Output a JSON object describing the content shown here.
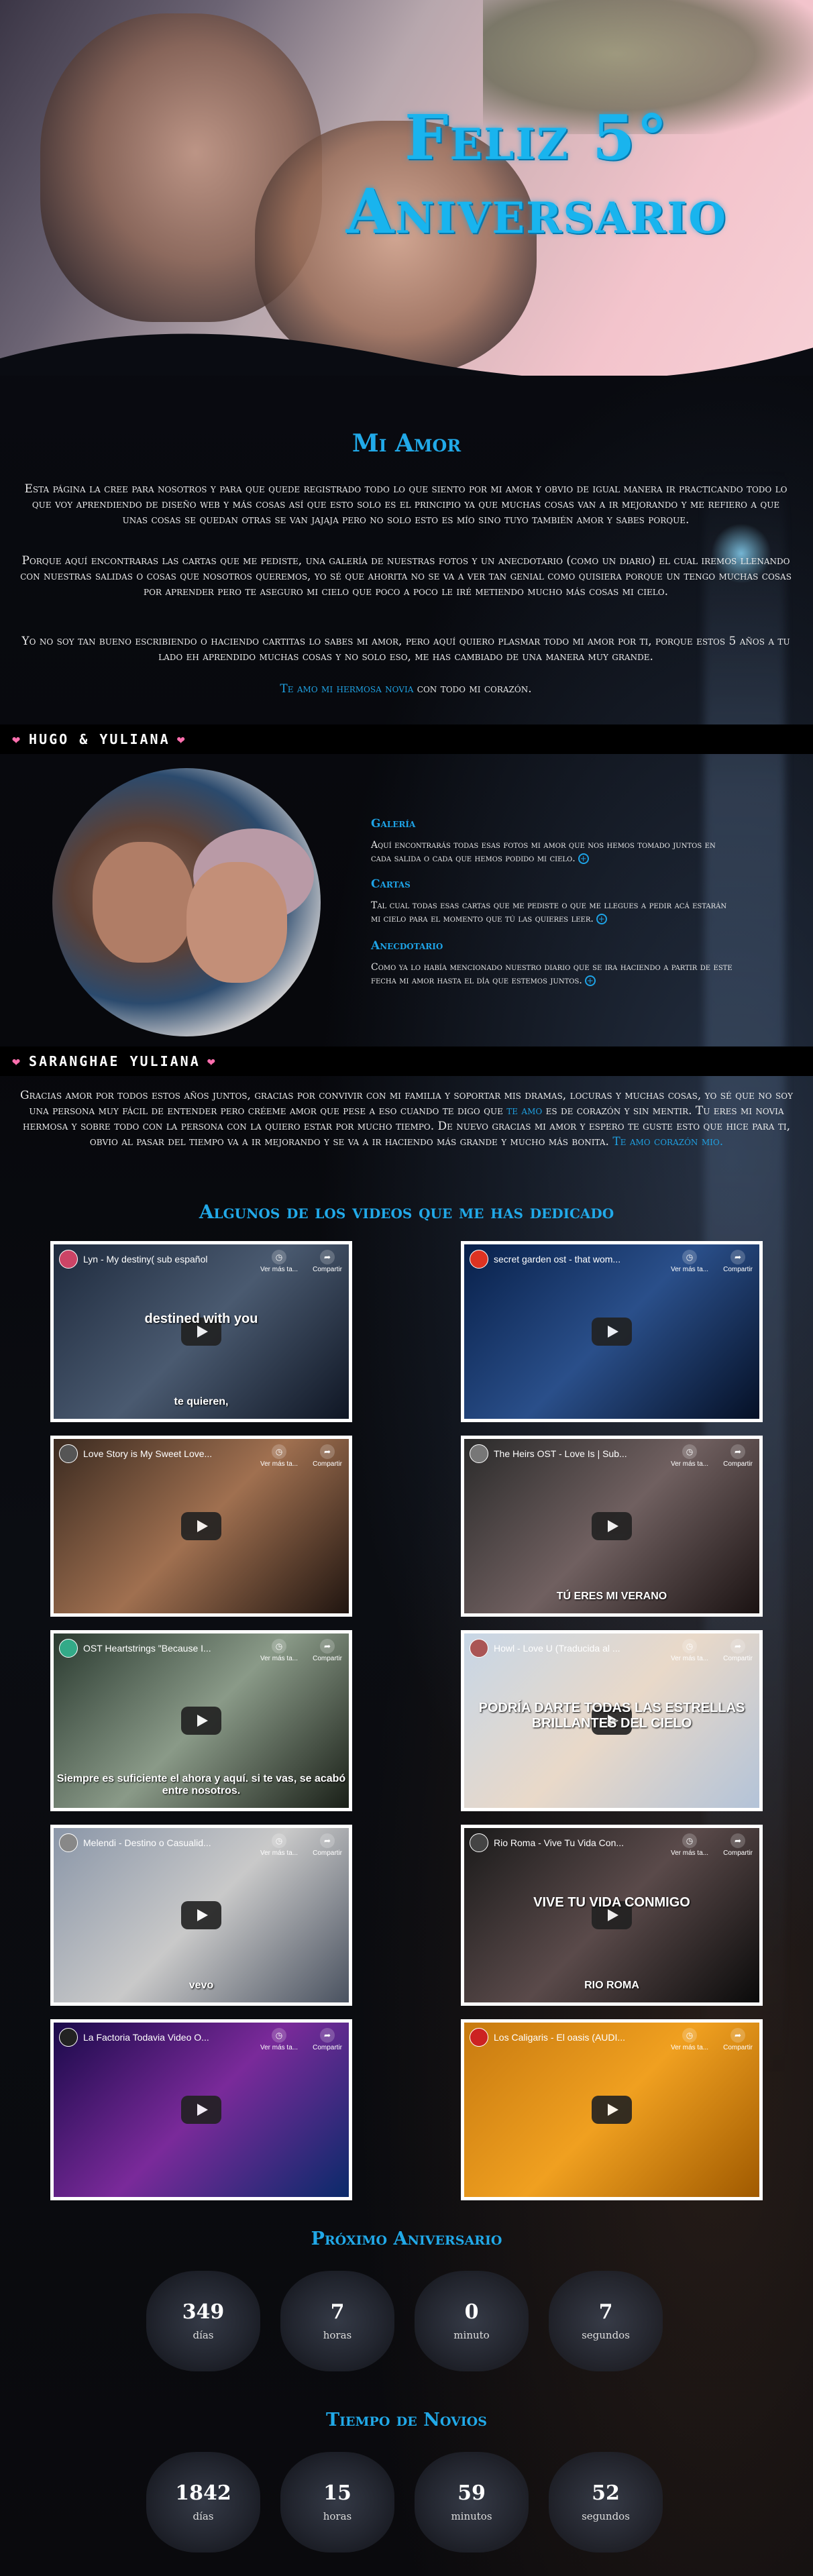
{
  "hero": {
    "title_line1": "Feliz 5°",
    "title_line2": "Aniversario"
  },
  "intro": {
    "heading": "Mi Amor",
    "p1": "Esta página la cree para nosotros y para que quede registrado todo lo que siento por mi amor y obvio de igual manera ir practicando todo lo que voy aprendiendo de diseño web y más cosas así que esto solo es el principio ya que muchas cosas van a ir mejorando y me refiero a que unas cosas se quedan otras se van jajaja pero no solo esto es mío sino tuyo también amor y sabes porque.",
    "p2": "Porque aquí encontraras las cartas que me pediste, una galería de nuestras fotos y un anecdotario (como un diario) el cual iremos llenando con nuestras salidas o cosas que nosotros queremos, yo sé que ahorita no se va a ver tan genial como quisiera porque un tengo muchas cosas por aprender pero te aseguro mi cielo que poco a poco le iré metiendo mucho más cosas mi cielo.",
    "p3": "Yo no soy tan bueno escribiendo o haciendo cartitas lo sabes mi amor, pero aquí quiero plasmar todo mi amor por ti, porque estos 5 años a tu lado eh aprendido muchas cosas y no solo eso, me has cambiado de una manera muy grande.",
    "love_highlight": "Te amo mi hermosa novia",
    "love_rest": " con todo mi corazón."
  },
  "banner1": {
    "text": "HUGO & YULIANA"
  },
  "features": [
    {
      "title": "Galería",
      "text": "Aquí encontrarás todas esas fotos mi amor que nos hemos tomado juntos en cada salida o cada que hemos podido mi cielo."
    },
    {
      "title": "Cartas",
      "text": "Tal cual todas esas cartas que me pediste o que me llegues a pedir acá estarán mi cielo para el momento que tú las quieres leer."
    },
    {
      "title": "Anecdotario",
      "text": "Como ya lo había mencionado nuestro diario que se ira haciendo a partir de este fecha mi amor hasta el día que estemos juntos."
    }
  ],
  "banner2": {
    "text": "SARANGHAE YULIANA"
  },
  "letter": {
    "text": "Gracias amor por todos estos años juntos, gracias por convivir con mi familia y soportar mis dramas, locuras y muchas cosas, yo sé que no soy una persona muy fácil de entender pero créeme amor que pese a eso cuando te digo que ",
    "hl1": "te amo",
    "text2": " es de corazón y sin mentir. Tu eres mi novia hermosa y sobre todo con la persona con la quiero estar por mucho tiempo. De nuevo gracias mi amor y espero te guste esto que hice para ti, obvio al pasar del tiempo va a ir mejorando y se va a ir haciendo más grande y mucho más bonita. ",
    "hl2": "Te amo corazón mio."
  },
  "videos_heading": "Algunos de los videos que me has dedicado",
  "videos": [
    {
      "title": "Lyn - My destiny( sub español",
      "caption_top": "destined with you",
      "caption_bot": "te quieren,"
    },
    {
      "title": "secret garden ost - that wom...",
      "caption_top": "",
      "caption_bot": ""
    },
    {
      "title": "Love Story is My Sweet Love...",
      "caption_top": "",
      "caption_bot": ""
    },
    {
      "title": "The Heirs OST - Love Is | Sub...",
      "caption_top": "",
      "caption_bot": "TÚ ERES MI VERANO"
    },
    {
      "title": "OST Heartstrings \"Because I...",
      "caption_top": "",
      "caption_bot": "Siempre es suficiente el ahora y aquí. si te vas, se acabó entre nosotros."
    },
    {
      "title": "Howl - Love U (Traducida al ...",
      "caption_top": "PODRÍA DARTE TODAS LAS ESTRELLAS BRILLANTES DEL CIELO",
      "caption_bot": ""
    },
    {
      "title": "Melendi - Destino o Casualid...",
      "caption_top": "",
      "caption_bot": "vevo"
    },
    {
      "title": "Rio Roma - Vive Tu Vida Con...",
      "caption_top": "VIVE TU VIDA CONMIGO",
      "caption_bot": "RIO ROMA"
    },
    {
      "title": "La Factoria Todavia Video O...",
      "caption_top": "",
      "caption_bot": ""
    },
    {
      "title": "Los Caligaris - El oasis (AUDI...",
      "caption_top": "",
      "caption_bot": ""
    }
  ],
  "video_ctrl": {
    "watch_later": "Ver más ta...",
    "share": "Compartir"
  },
  "next": {
    "heading": "Próximo Aniversario",
    "items": [
      {
        "value": "349",
        "unit": "días"
      },
      {
        "value": "7",
        "unit": "horas"
      },
      {
        "value": "0",
        "unit": "minuto"
      },
      {
        "value": "7",
        "unit": "segundos"
      }
    ]
  },
  "together": {
    "heading": "Tiempo de Novios",
    "items": [
      {
        "value": "1842",
        "unit": "días"
      },
      {
        "value": "15",
        "unit": "horas"
      },
      {
        "value": "59",
        "unit": "minutos"
      },
      {
        "value": "52",
        "unit": "segundos"
      }
    ]
  },
  "colors": {
    "accent": "#21a9e8",
    "hearts": "#ff6fae",
    "border": "#ffffff"
  }
}
